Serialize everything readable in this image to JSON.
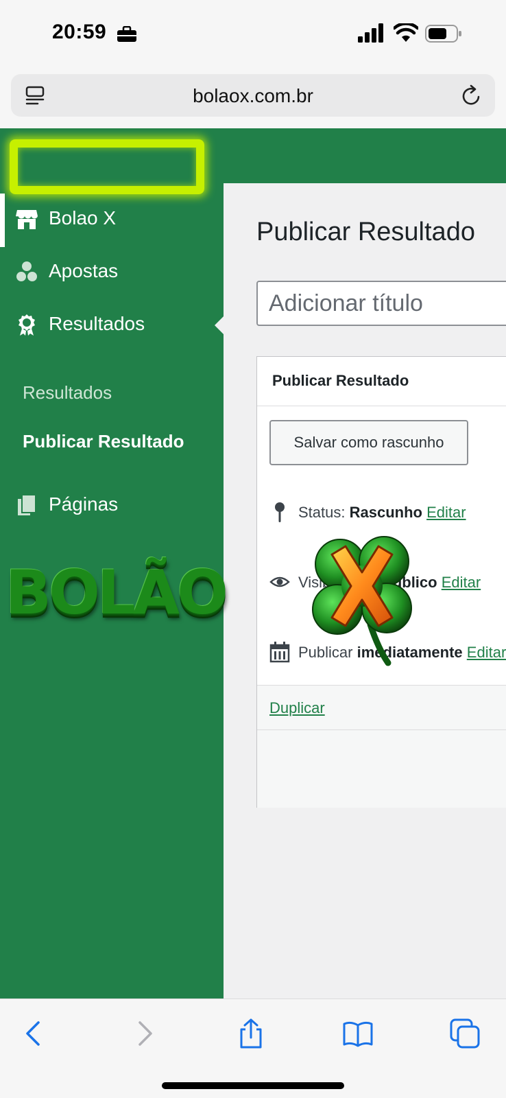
{
  "status_bar": {
    "time": "20:59"
  },
  "browser": {
    "url": "bolaox.com.br"
  },
  "sidebar": {
    "items": [
      {
        "label": "Bolao X",
        "icon": "store-icon"
      },
      {
        "label": "Apostas",
        "icon": "group-icon"
      },
      {
        "label": "Resultados",
        "icon": "award-icon"
      },
      {
        "label": "Páginas",
        "icon": "pages-icon"
      }
    ],
    "submenu": [
      {
        "label": "Resultados"
      },
      {
        "label": "Publicar Resultado"
      }
    ]
  },
  "main": {
    "page_title": "Publicar Resultado",
    "title_placeholder": "Adicionar título",
    "publish_box": {
      "title": "Publicar Resultado",
      "save_draft_label": "Salvar como rascunho",
      "status_label": "Status:",
      "status_value": "Rascunho",
      "visibility_label": "Visibilidade:",
      "visibility_value": "Público",
      "publish_label": "Publicar",
      "publish_value": "imediatamente",
      "edit_label": "Editar",
      "duplicate_label": "Duplicar"
    }
  },
  "logo": {
    "text": "BOLÃO",
    "mark": "X"
  },
  "colors": {
    "admin_green": "#218049",
    "highlight": "#c6f000",
    "link_green": "#218049",
    "ios_blue": "#1a73e8"
  }
}
